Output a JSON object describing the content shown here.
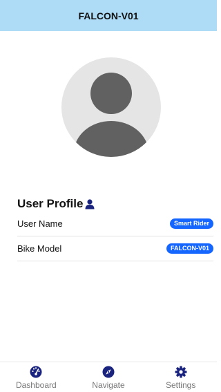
{
  "header": {
    "title": "FALCON-V01",
    "bg_color": "#aedcf7"
  },
  "avatar": {
    "icon": "default-user-avatar"
  },
  "profile": {
    "title": "User Profile",
    "title_icon": "person-icon",
    "rows": [
      {
        "label": "User Name",
        "value": "Smart Rider"
      },
      {
        "label": "Bike Model",
        "value": "FALCON-V01"
      }
    ],
    "badge_color": "#1565ff"
  },
  "bottom_nav": {
    "items": [
      {
        "label": "Dashboard",
        "icon": "speedometer-icon"
      },
      {
        "label": "Navigate",
        "icon": "compass-icon"
      },
      {
        "label": "Settings",
        "icon": "gear-icon"
      }
    ]
  }
}
